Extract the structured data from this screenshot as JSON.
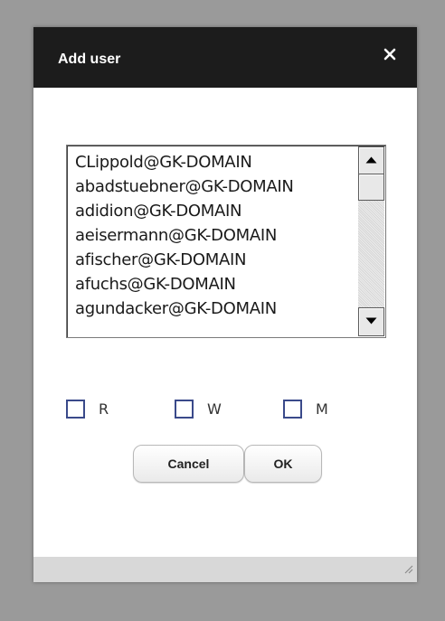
{
  "dialog": {
    "title": "Add user",
    "close_glyph": "×"
  },
  "user_list": {
    "items": [
      "CLippold@GK-DOMAIN",
      "abadstuebner@GK-DOMAIN",
      "adidion@GK-DOMAIN",
      "aeisermann@GK-DOMAIN",
      "afischer@GK-DOMAIN",
      "afuchs@GK-DOMAIN",
      "agundacker@GK-DOMAIN"
    ]
  },
  "permissions": [
    {
      "label": "R",
      "checked": false
    },
    {
      "label": "W",
      "checked": false
    },
    {
      "label": "M",
      "checked": false
    }
  ],
  "buttons": {
    "cancel": "Cancel",
    "ok": "OK"
  },
  "colors": {
    "titlebar": "#1c1c1c",
    "checkbox_border": "#3a4a8a",
    "backdrop": "#9a9a9a"
  }
}
